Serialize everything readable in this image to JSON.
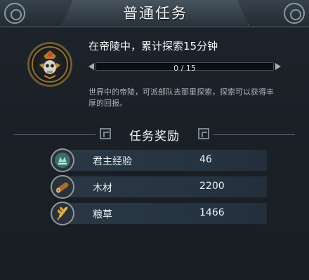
{
  "header": {
    "title": "普通任务"
  },
  "quest": {
    "name": "在帝陵中，累计探索15分钟",
    "progress_text": "0 / 15",
    "progress_fraction": 0,
    "description": "世界中的帝陵，可派部队去那里探索，探索可以获得丰厚的回报。"
  },
  "rewards": {
    "title": "任务奖励",
    "items": [
      {
        "name": "君主经验",
        "value": "46",
        "icon": "experience-icon"
      },
      {
        "name": "木材",
        "value": "2200",
        "icon": "wood-icon"
      },
      {
        "name": "粮草",
        "value": "1466",
        "icon": "grain-icon"
      }
    ]
  },
  "colors": {
    "accent": "#7fb2d8",
    "gold": "#c99a3a"
  }
}
